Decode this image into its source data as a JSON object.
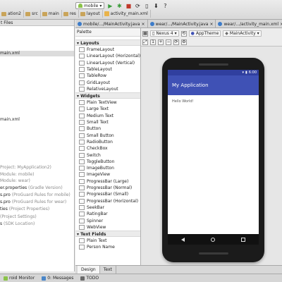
{
  "breadcrumbs": [
    "ation2",
    "src",
    "main",
    "res",
    "layout",
    "activity_main.xml"
  ],
  "toolbar": {
    "run_config": "mobile"
  },
  "left_panel": {
    "header": "t Files",
    "items": [
      {
        "label": "main.xml",
        "note": "",
        "selected": true
      },
      {
        "label": "main.xml",
        "note": "",
        "selected": false
      },
      {
        "label": "",
        "note": "Project: MyApplication2)",
        "selected": false
      },
      {
        "label": "",
        "note": "Module: mobile)",
        "selected": false
      },
      {
        "label": "",
        "note": "Module: wear)",
        "selected": false
      },
      {
        "label": "er.properties",
        "note": " (Gradle Version)",
        "selected": false
      },
      {
        "label": "s.pro",
        "note": " (ProGuard Rules for mobile)",
        "selected": false
      },
      {
        "label": "s.pro",
        "note": " (ProGuard Rules for wear)",
        "selected": false
      },
      {
        "label": "ties",
        "note": " (Project Properties)",
        "selected": false
      },
      {
        "label": "",
        "note": "(Project Settings)",
        "selected": false
      },
      {
        "label": "s",
        "note": " (SDK Location)",
        "selected": false
      }
    ]
  },
  "editor_tabs": [
    {
      "label": "mobile/.../MainActivity.java",
      "active": false
    },
    {
      "label": "wear/.../MainActivity.java",
      "active": false
    },
    {
      "label": "wear/.../activity_main.xml",
      "active": false
    }
  ],
  "palette": {
    "title": "Palette",
    "categories": [
      {
        "name": "Layouts",
        "items": [
          "FrameLayout",
          "LinearLayout (Horizontal)",
          "LinearLayout (Vertical)",
          "TableLayout",
          "TableRow",
          "GridLayout",
          "RelativeLayout"
        ]
      },
      {
        "name": "Widgets",
        "items": [
          "Plain TextView",
          "Large Text",
          "Medium Text",
          "Small Text",
          "Button",
          "Small Button",
          "RadioButton",
          "CheckBox",
          "Switch",
          "ToggleButton",
          "ImageButton",
          "ImageView",
          "ProgressBar (Large)",
          "ProgressBar (Normal)",
          "ProgressBar (Small)",
          "ProgressBar (Horizontal)",
          "SeekBar",
          "RatingBar",
          "Spinner",
          "WebView"
        ]
      },
      {
        "name": "Text Fields",
        "items": [
          "Plain Text",
          "Person Name"
        ]
      }
    ]
  },
  "design_toolbar": {
    "device": "Nexus 4",
    "theme": "AppTheme",
    "activity": "MainActivity"
  },
  "phone": {
    "status_time": "6:00",
    "app_title": "My Application",
    "content_text": "Hello World!"
  },
  "design_tabs": [
    {
      "label": "Design",
      "active": true
    },
    {
      "label": "Text",
      "active": false
    }
  ],
  "bottom_tabs": [
    {
      "label": "roid Monitor",
      "icon": "android-icon"
    },
    {
      "label": "0: Messages",
      "icon": "messages-icon"
    },
    {
      "label": "TODO",
      "icon": "todo-icon"
    }
  ],
  "colors": {
    "app_bar": "#3f51b5",
    "status_bar": "#303f9f"
  }
}
